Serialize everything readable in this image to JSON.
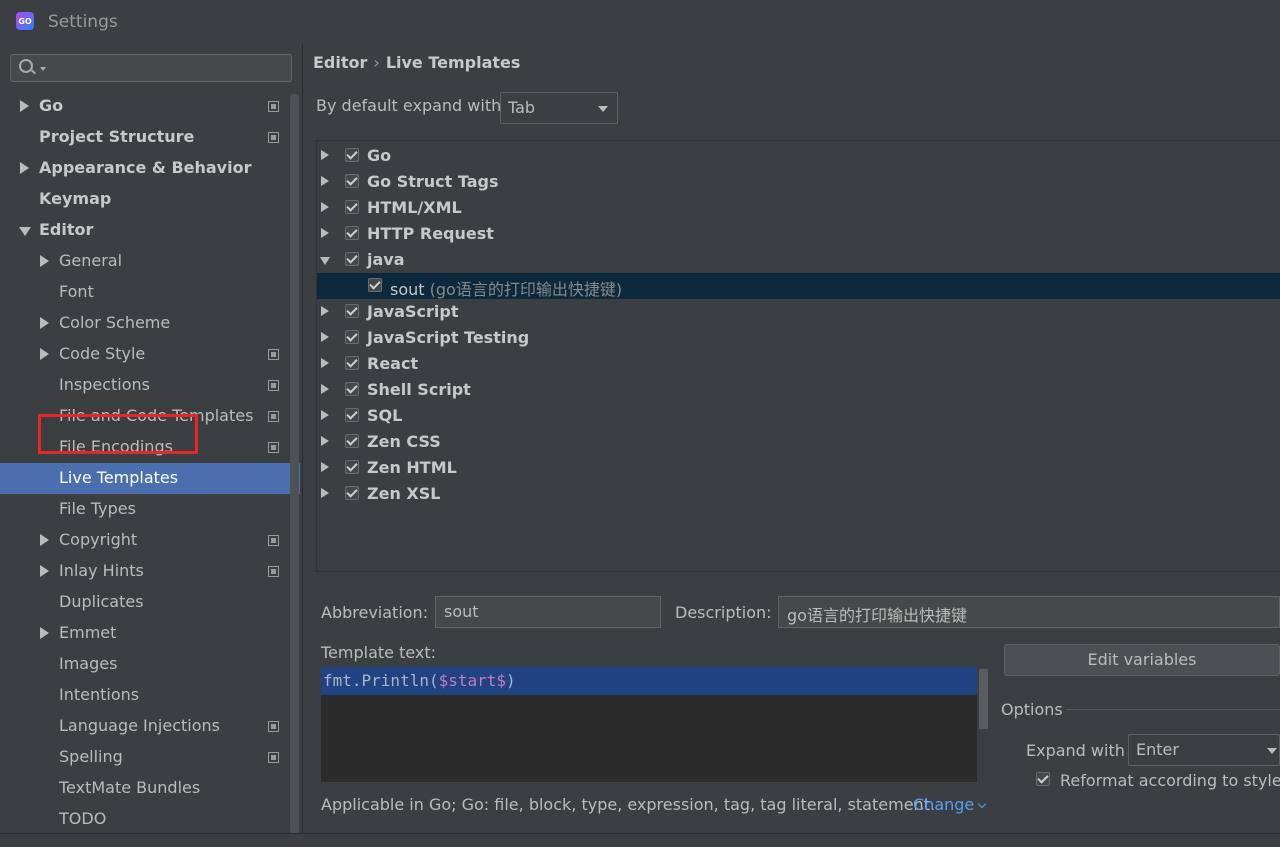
{
  "window": {
    "title": "Settings",
    "app_icon_text": "GO"
  },
  "sidebar": {
    "search": {
      "placeholder": ""
    },
    "items": [
      {
        "label": "Go",
        "expand": "collapsed",
        "level": 0,
        "bold": true,
        "project_icon": true
      },
      {
        "label": "Project Structure",
        "expand": "none",
        "level": 0,
        "bold": true,
        "project_icon": true
      },
      {
        "label": "Appearance & Behavior",
        "expand": "collapsed",
        "level": 0,
        "bold": true,
        "project_icon": false
      },
      {
        "label": "Keymap",
        "expand": "none",
        "level": 0,
        "bold": true,
        "project_icon": false
      },
      {
        "label": "Editor",
        "expand": "expanded",
        "level": 0,
        "bold": true,
        "project_icon": false
      },
      {
        "label": "General",
        "expand": "collapsed",
        "level": 1,
        "bold": false,
        "project_icon": false
      },
      {
        "label": "Font",
        "expand": "none",
        "level": 1,
        "bold": false,
        "project_icon": false
      },
      {
        "label": "Color Scheme",
        "expand": "collapsed",
        "level": 1,
        "bold": false,
        "project_icon": false
      },
      {
        "label": "Code Style",
        "expand": "collapsed",
        "level": 1,
        "bold": false,
        "project_icon": true
      },
      {
        "label": "Inspections",
        "expand": "none",
        "level": 1,
        "bold": false,
        "project_icon": true
      },
      {
        "label": "File and Code Templates",
        "expand": "none",
        "level": 1,
        "bold": false,
        "project_icon": true
      },
      {
        "label": "File Encodings",
        "expand": "none",
        "level": 1,
        "bold": false,
        "project_icon": true
      },
      {
        "label": "Live Templates",
        "expand": "none",
        "level": 1,
        "bold": false,
        "project_icon": false,
        "selected": true
      },
      {
        "label": "File Types",
        "expand": "none",
        "level": 1,
        "bold": false,
        "project_icon": false
      },
      {
        "label": "Copyright",
        "expand": "collapsed",
        "level": 1,
        "bold": false,
        "project_icon": true
      },
      {
        "label": "Inlay Hints",
        "expand": "collapsed",
        "level": 1,
        "bold": false,
        "project_icon": true
      },
      {
        "label": "Duplicates",
        "expand": "none",
        "level": 1,
        "bold": false,
        "project_icon": false
      },
      {
        "label": "Emmet",
        "expand": "collapsed",
        "level": 1,
        "bold": false,
        "project_icon": false
      },
      {
        "label": "Images",
        "expand": "none",
        "level": 1,
        "bold": false,
        "project_icon": false
      },
      {
        "label": "Intentions",
        "expand": "none",
        "level": 1,
        "bold": false,
        "project_icon": false
      },
      {
        "label": "Language Injections",
        "expand": "none",
        "level": 1,
        "bold": false,
        "project_icon": true
      },
      {
        "label": "Spelling",
        "expand": "none",
        "level": 1,
        "bold": false,
        "project_icon": true
      },
      {
        "label": "TextMate Bundles",
        "expand": "none",
        "level": 1,
        "bold": false,
        "project_icon": false
      },
      {
        "label": "TODO",
        "expand": "none",
        "level": 1,
        "bold": false,
        "project_icon": false
      }
    ]
  },
  "breadcrumb": {
    "parent": "Editor",
    "separator": "›",
    "current": "Live Templates"
  },
  "expand_default": {
    "label": "By default expand with",
    "value": "Tab"
  },
  "template_groups": [
    {
      "name": "Go",
      "checked": true,
      "expand": "collapsed"
    },
    {
      "name": "Go Struct Tags",
      "checked": true,
      "expand": "collapsed"
    },
    {
      "name": "HTML/XML",
      "checked": true,
      "expand": "collapsed"
    },
    {
      "name": "HTTP Request",
      "checked": true,
      "expand": "collapsed"
    },
    {
      "name": "java",
      "checked": true,
      "expand": "expanded",
      "children": [
        {
          "abbr": "sout",
          "desc": "(go语言的打印输出快捷键)",
          "checked": true,
          "selected": true
        }
      ]
    },
    {
      "name": "JavaScript",
      "checked": true,
      "expand": "collapsed"
    },
    {
      "name": "JavaScript Testing",
      "checked": true,
      "expand": "collapsed"
    },
    {
      "name": "React",
      "checked": true,
      "expand": "collapsed"
    },
    {
      "name": "Shell Script",
      "checked": true,
      "expand": "collapsed"
    },
    {
      "name": "SQL",
      "checked": true,
      "expand": "collapsed"
    },
    {
      "name": "Zen CSS",
      "checked": true,
      "expand": "collapsed"
    },
    {
      "name": "Zen HTML",
      "checked": true,
      "expand": "collapsed"
    },
    {
      "name": "Zen XSL",
      "checked": true,
      "expand": "collapsed"
    }
  ],
  "details": {
    "abbreviation_label": "Abbreviation:",
    "abbreviation_value": "sout",
    "description_label": "Description:",
    "description_value": "go语言的打印输出快捷键",
    "template_text_label": "Template text:",
    "template_code_prefix": "fmt.Println(",
    "template_code_var": "$start$",
    "template_code_suffix": ")",
    "edit_variables_label": "Edit variables",
    "options_label": "Options",
    "expand_with_label": "Expand with",
    "expand_with_value": "Enter",
    "reformat_label": "Reformat according to style",
    "reformat_checked": true,
    "applicable_text": "Applicable in Go; Go: file, block, type, expression, tag, tag literal, statement.",
    "change_link": "Change"
  },
  "colors": {
    "background": "#3c3f41",
    "selection": "#4b6eaf",
    "row_selection": "#0d293e",
    "annotation_box": "#e8262a",
    "link": "#589df6"
  }
}
